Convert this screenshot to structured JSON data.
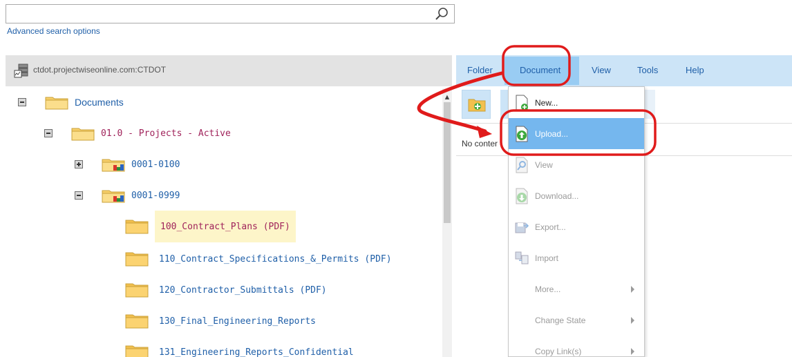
{
  "search": {
    "value": "",
    "placeholder": "",
    "icon": "search-icon"
  },
  "advanced_search_label": "Advanced search options",
  "tree": {
    "server_label": "ctdot.projectwiseonline.com:CTDOT",
    "nodes": [
      {
        "label": "Documents",
        "toggle": "minus",
        "selected": false
      },
      {
        "label": "01.0 - Projects - Active",
        "toggle": "minus",
        "selected": true
      },
      {
        "label": "0001-0100",
        "toggle": "plus",
        "selected": false
      },
      {
        "label": "0001-0999",
        "toggle": "minus",
        "selected": false
      },
      {
        "label": "100_Contract_Plans (PDF)",
        "toggle": "",
        "selected": true,
        "highlighted": true
      },
      {
        "label": "110_Contract_Specifications_&_Permits (PDF)",
        "toggle": "",
        "selected": false
      },
      {
        "label": "120_Contractor_Submittals (PDF)",
        "toggle": "",
        "selected": false
      },
      {
        "label": "130_Final_Engineering_Reports",
        "toggle": "",
        "selected": false
      },
      {
        "label": "131_Engineering_Reports_Confidential",
        "toggle": "",
        "selected": false
      }
    ]
  },
  "menubar": {
    "folder": "Folder",
    "document": "Document",
    "view": "View",
    "tools": "Tools",
    "help": "Help"
  },
  "content": {
    "no_content": "No conter"
  },
  "document_menu": {
    "items": [
      {
        "label": "New...",
        "icon": "new-document-icon",
        "enabled": true
      },
      {
        "label": "Upload...",
        "icon": "upload-icon",
        "enabled": true,
        "active": true
      },
      {
        "label": "View",
        "icon": "view-icon",
        "enabled": false
      },
      {
        "label": "Download...",
        "icon": "download-icon",
        "enabled": false
      },
      {
        "label": "Export...",
        "icon": "export-icon",
        "enabled": false
      },
      {
        "label": "Import",
        "icon": "import-icon",
        "enabled": false
      },
      {
        "label": "More...",
        "icon": "",
        "enabled": false,
        "submenu": true
      },
      {
        "label": "Change State",
        "icon": "",
        "enabled": false,
        "submenu": true
      },
      {
        "label": "Copy Link(s)",
        "icon": "",
        "enabled": false,
        "submenu": true
      }
    ]
  },
  "colors": {
    "link": "#1f5fa8",
    "selected": "#a0235b",
    "menubar_bg": "#cce4f7",
    "menu_active_bg": "#75b7ee",
    "annotation_red": "#e01b1b",
    "highlight_bg": "#fdf5c9"
  }
}
